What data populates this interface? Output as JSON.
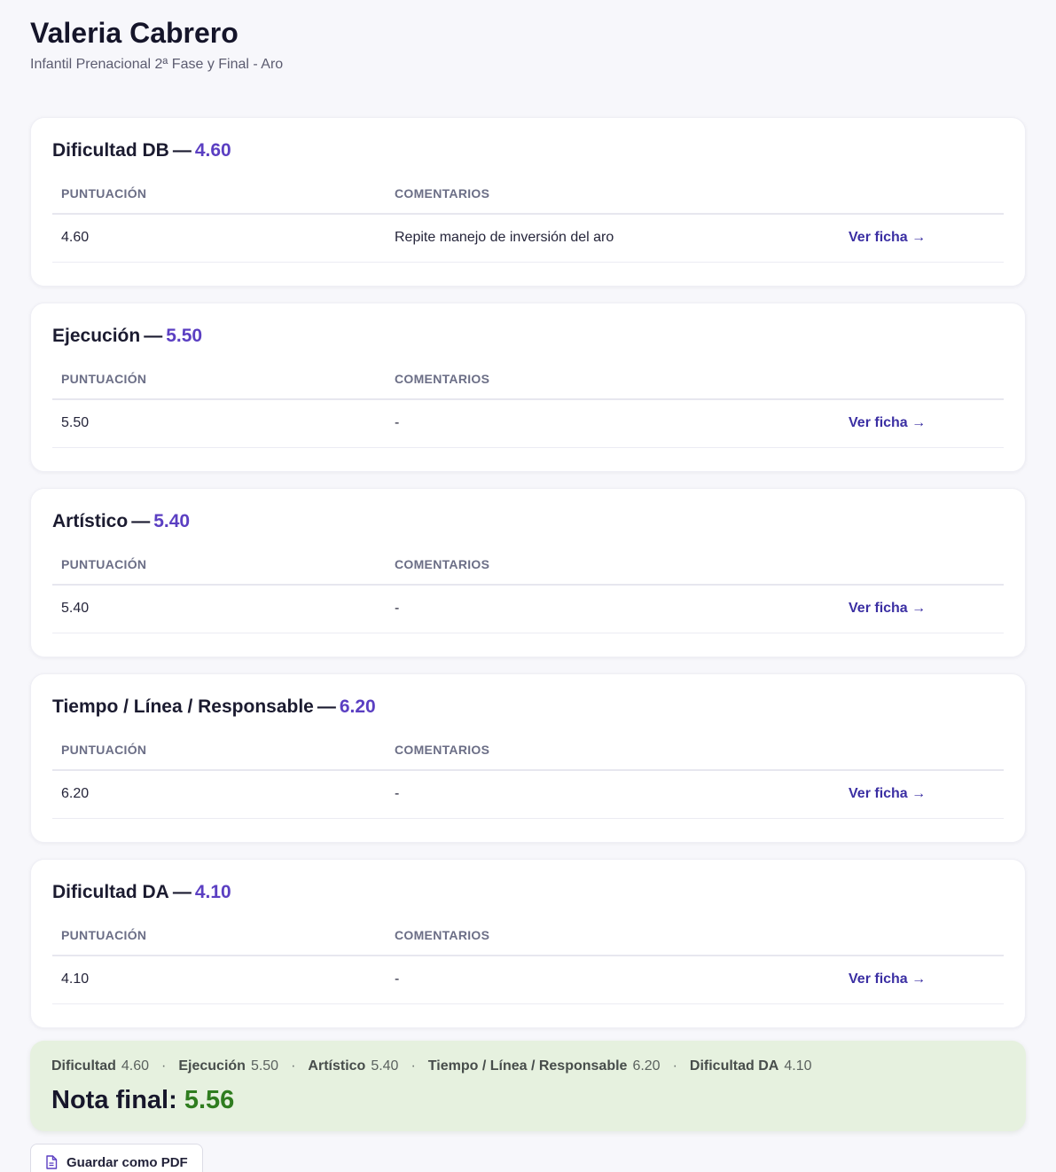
{
  "athlete": {
    "name": "Valeria Cabrero",
    "category": "Infantil Prenacional 2ª Fase y Final - Aro"
  },
  "table_headers": {
    "score": "PUNTUACIÓN",
    "comments": "COMENTARIOS"
  },
  "link_label": "Ver ficha →",
  "title_separator": "—",
  "sections": [
    {
      "title": "Dificultad DB",
      "score": "4.60",
      "row_score": "4.60",
      "comment": "Repite manejo de inversión del aro"
    },
    {
      "title": "Ejecución",
      "score": "5.50",
      "row_score": "5.50",
      "comment": "-"
    },
    {
      "title": "Artístico",
      "score": "5.40",
      "row_score": "5.40",
      "comment": "-"
    },
    {
      "title": "Tiempo / Línea / Responsable",
      "score": "6.20",
      "row_score": "6.20",
      "comment": "-"
    },
    {
      "title": "Dificultad DA",
      "score": "4.10",
      "row_score": "4.10",
      "comment": "-"
    }
  ],
  "summary": {
    "separator": "·",
    "items": [
      {
        "label": "Dificultad",
        "value": "4.60"
      },
      {
        "label": "Ejecución",
        "value": "5.50"
      },
      {
        "label": "Artístico",
        "value": "5.40"
      },
      {
        "label": "Tiempo / Línea / Responsable",
        "value": "6.20"
      },
      {
        "label": "Dificultad DA",
        "value": "4.10"
      }
    ],
    "final_label": "Nota final:",
    "final_value": "5.56"
  },
  "actions": {
    "save_pdf_label": "Guardar como PDF",
    "save_pdf_icon": "document-icon"
  },
  "colors": {
    "accent": "#5b3fc2",
    "link": "#3b2fa3",
    "final_score": "#2f7d1f",
    "summary_bg": "#e6f1df"
  }
}
